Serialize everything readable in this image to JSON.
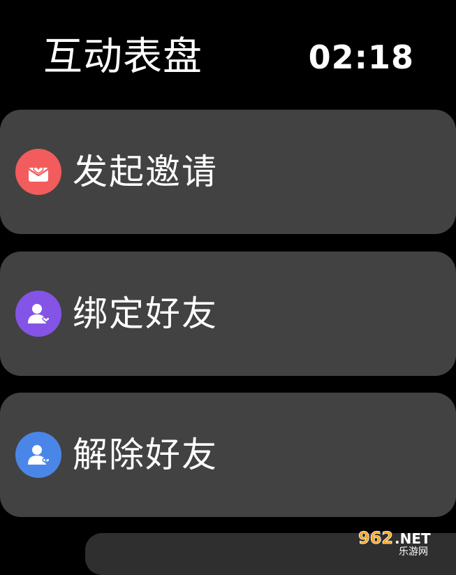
{
  "header": {
    "title": "互动表盘",
    "time": "02:18"
  },
  "menu": {
    "items": [
      {
        "label": "发起邀请",
        "icon": "mail-heart-icon",
        "icon_color": "#F25C5C"
      },
      {
        "label": "绑定好友",
        "icon": "person-heart-icon",
        "icon_color": "#8454E6"
      },
      {
        "label": "解除好友",
        "icon": "person-broken-heart-icon",
        "icon_color": "#4A86E8"
      }
    ]
  },
  "watermark": {
    "brand": "962.NET",
    "tagline": "乐游网"
  }
}
